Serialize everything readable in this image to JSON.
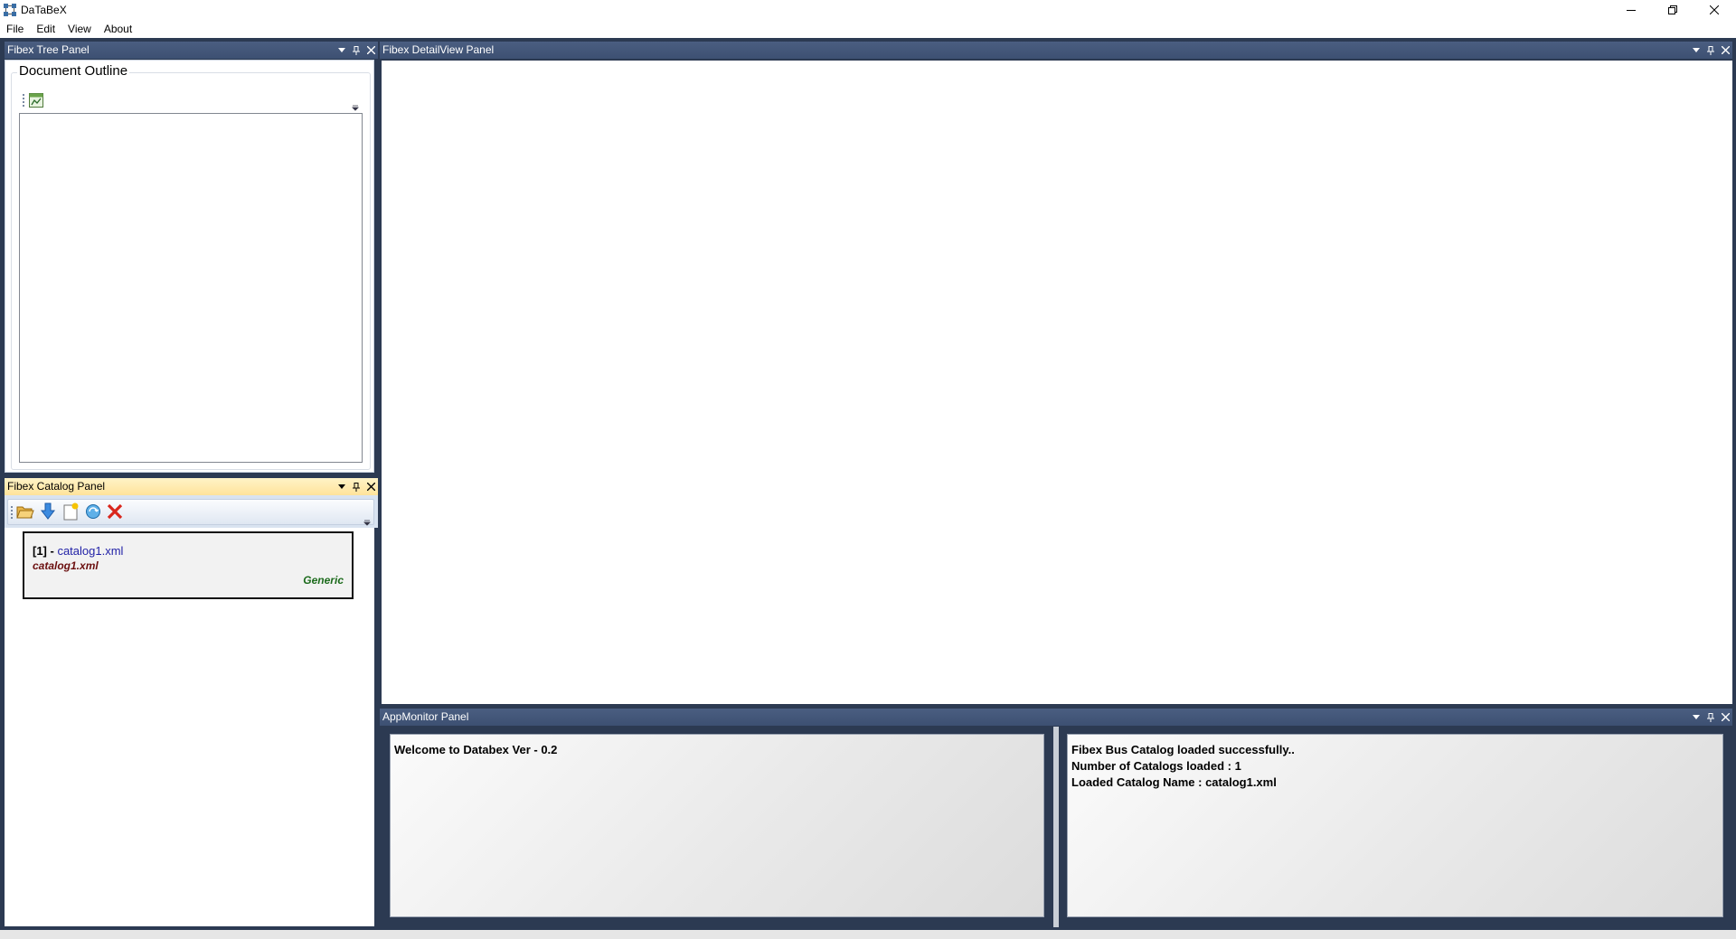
{
  "window": {
    "title": "DaTaBeX",
    "controls": [
      "minimize",
      "restore",
      "close"
    ]
  },
  "menu": {
    "items": [
      "File",
      "Edit",
      "View",
      "About"
    ]
  },
  "tree_panel": {
    "title": "Fibex Tree Panel",
    "outline_title": "Document Outline"
  },
  "catalog_panel": {
    "title": "Fibex Catalog Panel",
    "toolbar": [
      "open-folder-icon",
      "download-icon",
      "new-document-icon",
      "refresh-icon",
      "delete-icon"
    ],
    "items": [
      {
        "index_prefix": "[1] - ",
        "name": "catalog1.xml",
        "file": "catalog1.xml",
        "type": "Generic"
      }
    ]
  },
  "detail_panel": {
    "title": "Fibex DetailView Panel"
  },
  "monitor_panel": {
    "title": "AppMonitor Panel",
    "left_lines": [
      "Welcome to Databex Ver - 0.2"
    ],
    "right_lines": [
      "Fibex Bus Catalog loaded successfully..",
      "Number of Catalogs loaded : 1",
      "Loaded Catalog Name : catalog1.xml"
    ]
  },
  "colors": {
    "dock_background": "#2c3a52",
    "panel_header": "#3d5072",
    "active_header": "#ffe39a",
    "catalog_name_link": "#1f1fa6",
    "catalog_file": "#6b0f0f",
    "catalog_type": "#1c6b1c"
  }
}
